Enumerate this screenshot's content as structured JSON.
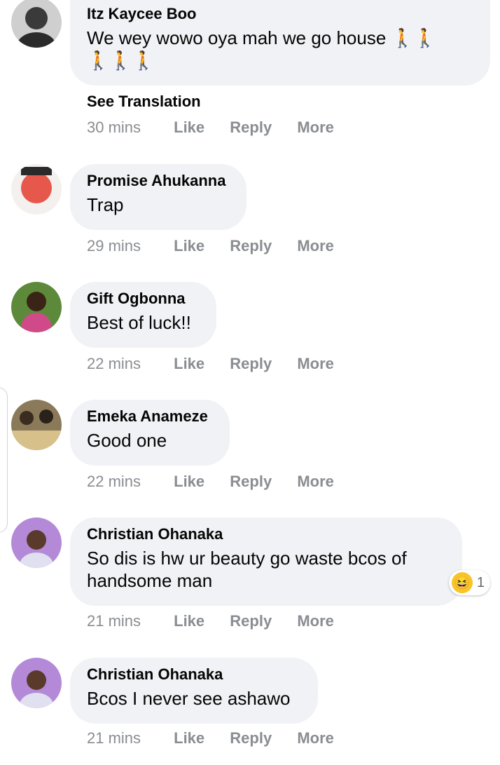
{
  "comments": [
    {
      "name": "Itz Kaycee Boo",
      "text": "We wey wowo oya mah we go house",
      "emoji_line1": "🚶🚶",
      "emoji_line2": "🚶🚶🚶",
      "see_translation": "See Translation",
      "time": "30 mins",
      "like": "Like",
      "reply": "Reply",
      "more": "More",
      "avatar_color": "#3a3a3a"
    },
    {
      "name": "Promise Ahukanna",
      "text": "Trap",
      "time": "29 mins",
      "like": "Like",
      "reply": "Reply",
      "more": "More",
      "avatar_color": "#e0554a"
    },
    {
      "name": "Gift Ogbonna",
      "text": "Best of luck!!",
      "time": "22 mins",
      "like": "Like",
      "reply": "Reply",
      "more": "More",
      "avatar_color": "#6a8d3a"
    },
    {
      "name": "Emeka Anameze",
      "text": "Good one",
      "time": "22 mins",
      "like": "Like",
      "reply": "Reply",
      "more": "More",
      "avatar_color": "#7a6a4a"
    },
    {
      "name": "Christian Ohanaka",
      "text_line1": "So dis is hw ur beauty go waste bcos of",
      "text_line2": "handsome man",
      "time": "21 mins",
      "like": "Like",
      "reply": "Reply",
      "more": "More",
      "reaction_count": "1",
      "avatar_color": "#8a5ab8"
    },
    {
      "name": "Christian Ohanaka",
      "text": "Bcos I never see ashawo",
      "time": "21 mins",
      "like": "Like",
      "reply": "Reply",
      "more": "More",
      "avatar_color": "#8a5ab8"
    }
  ]
}
